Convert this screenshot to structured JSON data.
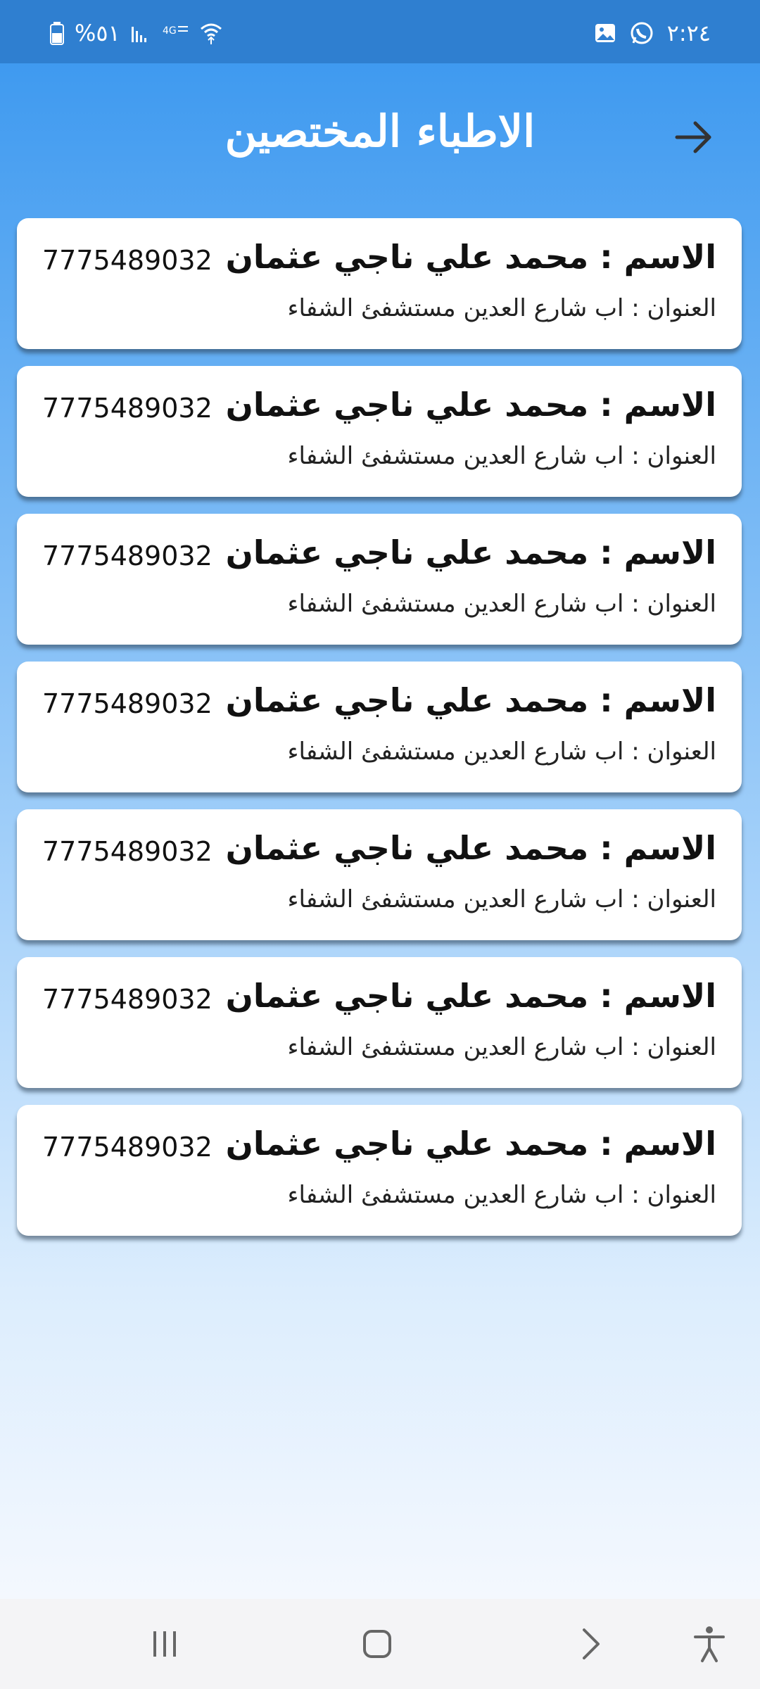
{
  "status_bar": {
    "time": "٢:٢٤",
    "battery": "%٥١",
    "icons": [
      "image-icon",
      "whatsapp-icon",
      "battery-icon",
      "signal-icon",
      "4g-icon",
      "wifi-icon"
    ]
  },
  "header": {
    "title": "الاطباء المختصين",
    "back_icon": "arrow-right-icon"
  },
  "doctors": [
    {
      "name": "الاسم : محمد علي ناجي عثمان",
      "address": "العنوان : اب شارع العدين مستشفئ الشفاء",
      "phone": "7775489032"
    },
    {
      "name": "الاسم : محمد علي ناجي عثمان",
      "address": "العنوان : اب شارع العدين مستشفئ الشفاء",
      "phone": "7775489032"
    },
    {
      "name": "الاسم : محمد علي ناجي عثمان",
      "address": "العنوان : اب شارع العدين مستشفئ الشفاء",
      "phone": "7775489032"
    },
    {
      "name": "الاسم : محمد علي ناجي عثمان",
      "address": "العنوان : اب شارع العدين مستشفئ الشفاء",
      "phone": "7775489032"
    },
    {
      "name": "الاسم : محمد علي ناجي عثمان",
      "address": "العنوان : اب شارع العدين مستشفئ الشفاء",
      "phone": "7775489032"
    },
    {
      "name": "الاسم : محمد علي ناجي عثمان",
      "address": "العنوان : اب شارع العدين مستشفئ الشفاء",
      "phone": "7775489032"
    },
    {
      "name": "الاسم : محمد علي ناجي عثمان",
      "address": "العنوان : اب شارع العدين مستشفئ الشفاء",
      "phone": "7775489032"
    }
  ],
  "nav_bar": {
    "icons": [
      "recent-apps-icon",
      "home-icon",
      "back-icon",
      "accessibility-icon"
    ]
  },
  "colors": {
    "status_bar": "#2f7fd0",
    "gradient_top": "#3f9af0",
    "gradient_bottom": "#f4f8fe",
    "card": "#ffffff"
  }
}
